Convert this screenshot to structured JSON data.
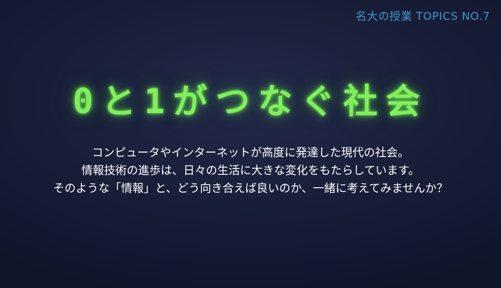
{
  "header": {
    "series_tag": "名大の授業 TOPICS NO.7"
  },
  "headline": {
    "text": "0と1がつなぐ社会",
    "color": "#7ff05a"
  },
  "description": {
    "lines": [
      "コンピュータやインターネットが高度に発達した現代の社会。",
      "情報技術の進歩は、日々の生活に大きな変化をもたらしています。",
      "そのような「情報」と、どう向き合えば良いのか、一緒に考えてみませんか？"
    ]
  },
  "colors": {
    "background": "#1a1f3a",
    "series_tag": "#3f93c9",
    "body_text": "#ffffff"
  }
}
